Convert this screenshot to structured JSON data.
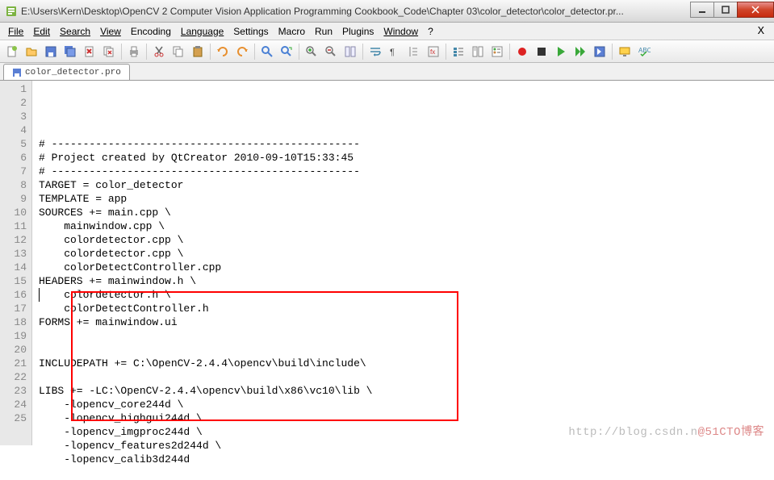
{
  "window": {
    "title": "E:\\Users\\Kern\\Desktop\\OpenCV 2 Computer Vision Application Programming Cookbook_Code\\Chapter 03\\color_detector\\color_detector.pr..."
  },
  "menu": {
    "file": "File",
    "edit": "Edit",
    "search": "Search",
    "view": "View",
    "encoding": "Encoding",
    "language": "Language",
    "settings": "Settings",
    "macro": "Macro",
    "run": "Run",
    "plugins": "Plugins",
    "window": "Window",
    "help": "?",
    "close_x": "X"
  },
  "toolbar_icons": [
    "new-file-icon",
    "open-icon",
    "save-icon",
    "save-all-icon",
    "close-icon",
    "close-all-icon",
    "print-icon",
    "cut-icon",
    "copy-icon",
    "paste-icon",
    "undo-icon",
    "redo-icon",
    "find-icon",
    "replace-icon",
    "zoom-in-icon",
    "zoom-out-icon",
    "sync-scroll-icon",
    "word-wrap-icon",
    "show-chars-icon",
    "indent-guide-icon",
    "folder-icon",
    "doc-map-icon",
    "func-list-icon",
    "record-icon",
    "stop-icon",
    "play-icon",
    "play-all-icon",
    "save-macro-icon",
    "monitor-icon",
    "spellcheck-icon"
  ],
  "tabs": {
    "items": [
      {
        "label": "color_detector.pro"
      }
    ]
  },
  "editor": {
    "lines": [
      "# -------------------------------------------------",
      "# Project created by QtCreator 2010-09-10T15:33:45",
      "# -------------------------------------------------",
      "TARGET = color_detector",
      "TEMPLATE = app",
      "SOURCES += main.cpp \\",
      "    mainwindow.cpp \\",
      "    colordetector.cpp \\",
      "    colordetector.cpp \\",
      "    colorDetectController.cpp",
      "HEADERS += mainwindow.h \\",
      "    colordetector.h \\",
      "    colorDetectController.h",
      "FORMS += mainwindow.ui",
      "",
      "",
      "INCLUDEPATH += C:\\OpenCV-2.4.4\\opencv\\build\\include\\",
      "",
      "LIBS += -LC:\\OpenCV-2.4.4\\opencv\\build\\x86\\vc10\\lib \\",
      "    -lopencv_core244d \\",
      "    -lopencv_highgui244d \\",
      "    -lopencv_imgproc244d \\",
      "    -lopencv_features2d244d \\",
      "    -lopencv_calib3d244d",
      ""
    ]
  },
  "watermark": {
    "text_left": "http://blog.csdn.n",
    "text_right": "@51CTO博客"
  }
}
